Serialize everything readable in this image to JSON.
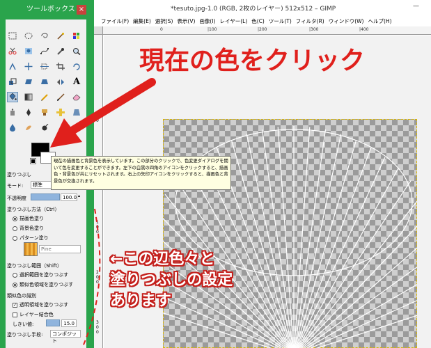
{
  "toolbox": {
    "title": "ツールボックス",
    "close_icon": "×",
    "tool_icons": [
      "rect-select-icon",
      "ellipse-select-icon",
      "lasso-icon",
      "fuzzy-select-icon",
      "color-select-icon",
      "scissors-icon",
      "foreground-select-icon",
      "paths-icon",
      "color-picker-icon",
      "zoom-icon",
      "measure-icon",
      "move-icon",
      "align-icon",
      "crop-icon",
      "rotate-icon",
      "scale-icon",
      "shear-icon",
      "perspective-icon",
      "flip-icon",
      "text-icon",
      "bucket-fill-icon",
      "gradient-icon",
      "pencil-icon",
      "paintbrush-icon",
      "eraser-icon",
      "airbrush-icon",
      "ink-icon",
      "clone-icon",
      "heal-icon",
      "perspective-clone-icon",
      "blur-icon",
      "smudge-icon",
      "dodge-burn-icon"
    ],
    "fg_color": "#000000",
    "bg_color": "#ffffff",
    "options_title": "塗りつぶし",
    "mode_label": "モード:",
    "mode_value": "標準",
    "opacity_label": "不透明度",
    "opacity_value": "100.0",
    "fill_type_label": "塗りつぶし方法（Ctrl）",
    "fill_fg": "描画色塗り",
    "fill_bg": "背景色塗り",
    "fill_pattern": "パターン塗り",
    "pattern_name": "Pine",
    "affected_label": "塗りつぶし範囲（Shift）",
    "affected_selection": "選択範囲を塗りつぶす",
    "affected_similar": "類似色領域を塗りつぶす",
    "similar_title": "類似色の識別",
    "transparent_check": "透明領域を塗りつぶす",
    "sample_merged": "レイヤー結合色",
    "threshold_label": "しきい値:",
    "threshold_value": "15.0",
    "fill_by_label": "塗りつぶし手段:",
    "fill_by_value": "コンポジット"
  },
  "window": {
    "title": "*tesuto.jpg-1.0 (RGB, 2枚のレイヤー) 512x512 – GIMP",
    "minimize": "—",
    "menu": [
      "ファイル(F)",
      "編集(E)",
      "選択(S)",
      "表示(V)",
      "画像(I)",
      "レイヤー(L)",
      "色(C)",
      "ツール(T)",
      "フィルタ(R)",
      "ウィンドウ(W)",
      "ヘルプ(H)"
    ],
    "ruler_top": [
      "0",
      "|100",
      "|200",
      "|300",
      "|400"
    ],
    "ruler_left": [
      "0",
      "1",
      "0",
      "0",
      "2",
      "0",
      "0",
      "3",
      "0",
      "0"
    ]
  },
  "tooltip": {
    "text": "現在の描画色と背景色を表示しています。この部分のクリックで、色変更ダイアログを開いて色を変更することができます。左下の白黒の四角のアイコンをクリックすると、描画色・背景色が共にリセットされます。右上の矢印アイコンをクリックすると、描画色と背景色が交換されます。"
  },
  "annotations": {
    "headline": "現在の色をクリック",
    "note_line1": "←この辺色々と",
    "note_line2": "塗りつぶしの設定",
    "note_line3": "あります"
  },
  "colors": {
    "annotation_red": "#e0201c",
    "toolbox_green": "#2aa44c",
    "selection_yellow": "#d8b400"
  }
}
